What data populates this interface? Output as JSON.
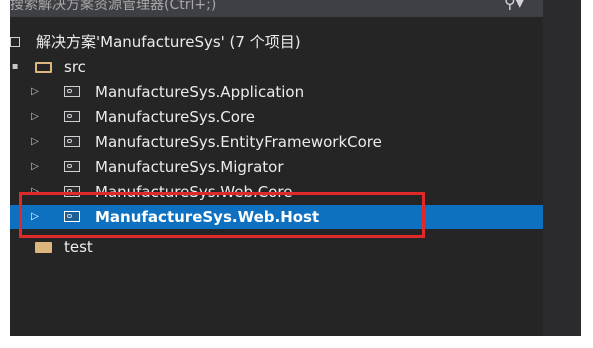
{
  "search": {
    "placeholder": "搜索解决方案资源管理器(Ctrl+;)"
  },
  "tree": {
    "solution_label": "解决方案'ManufactureSys' (7 个项目)",
    "folders": {
      "src": "src",
      "test": "test"
    },
    "projects": [
      {
        "label": "ManufactureSys.Application",
        "selected": false
      },
      {
        "label": "ManufactureSys.Core",
        "selected": false
      },
      {
        "label": "ManufactureSys.EntityFrameworkCore",
        "selected": false
      },
      {
        "label": "ManufactureSys.Migrator",
        "selected": false
      },
      {
        "label": "ManufactureSys.Web.Core",
        "selected": false
      },
      {
        "label": "ManufactureSys.Web.Host",
        "selected": true
      }
    ]
  },
  "icons": {
    "search": "search-icon",
    "expand": "expand-arrow-icon",
    "project": "csharp-project-icon",
    "folder": "folder-icon",
    "solution": "solution-icon"
  },
  "colors": {
    "background": "#252526",
    "selection": "#0e70c0",
    "highlight_box": "#e02a2a",
    "folder": "#dcb67a"
  }
}
